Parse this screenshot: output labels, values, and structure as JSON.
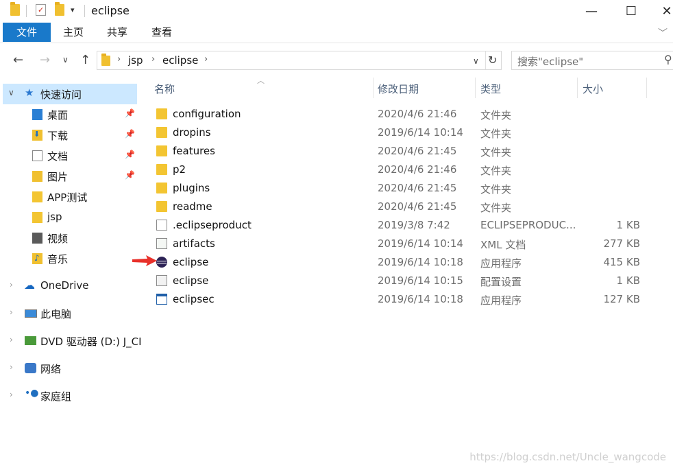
{
  "window": {
    "title": "eclipse",
    "minimize": "—",
    "maximize": "☐",
    "close": "✕"
  },
  "ribbon": {
    "tabs": [
      "文件",
      "主页",
      "共享",
      "查看"
    ],
    "expand": "﹀"
  },
  "address": {
    "breadcrumbs": [
      "jsp",
      "eclipse"
    ],
    "search_placeholder": "搜索\"eclipse\""
  },
  "nav": {
    "quick_access": "快速访问",
    "quick_items": [
      {
        "label": "桌面",
        "pinned": true
      },
      {
        "label": "下载",
        "pinned": true
      },
      {
        "label": "文档",
        "pinned": true
      },
      {
        "label": "图片",
        "pinned": true
      },
      {
        "label": "APP测试",
        "pinned": false
      },
      {
        "label": "jsp",
        "pinned": false
      },
      {
        "label": "视频",
        "pinned": false
      },
      {
        "label": "音乐",
        "pinned": false
      }
    ],
    "roots": [
      "OneDrive",
      "此电脑",
      "DVD 驱动器 (D:) J_CI",
      "网络",
      "家庭组"
    ]
  },
  "columns": [
    "名称",
    "修改日期",
    "类型",
    "大小"
  ],
  "files": [
    {
      "name": "configuration",
      "date": "2020/4/6 21:46",
      "type": "文件夹",
      "size": "",
      "icon": "folder"
    },
    {
      "name": "dropins",
      "date": "2019/6/14 10:14",
      "type": "文件夹",
      "size": "",
      "icon": "folder"
    },
    {
      "name": "features",
      "date": "2020/4/6 21:45",
      "type": "文件夹",
      "size": "",
      "icon": "folder"
    },
    {
      "name": "p2",
      "date": "2020/4/6 21:46",
      "type": "文件夹",
      "size": "",
      "icon": "folder"
    },
    {
      "name": "plugins",
      "date": "2020/4/6 21:45",
      "type": "文件夹",
      "size": "",
      "icon": "folder"
    },
    {
      "name": "readme",
      "date": "2020/4/6 21:45",
      "type": "文件夹",
      "size": "",
      "icon": "folder"
    },
    {
      "name": ".eclipseproduct",
      "date": "2019/3/8 7:42",
      "type": "ECLIPSEPRODUC...",
      "size": "1 KB",
      "icon": "file"
    },
    {
      "name": "artifacts",
      "date": "2019/6/14 10:14",
      "type": "XML 文档",
      "size": "277 KB",
      "icon": "xml"
    },
    {
      "name": "eclipse",
      "date": "2019/6/14 10:18",
      "type": "应用程序",
      "size": "415 KB",
      "icon": "eclipse"
    },
    {
      "name": "eclipse",
      "date": "2019/6/14 10:15",
      "type": "配置设置",
      "size": "1 KB",
      "icon": "ini"
    },
    {
      "name": "eclipsec",
      "date": "2019/6/14 10:18",
      "type": "应用程序",
      "size": "127 KB",
      "icon": "app"
    }
  ],
  "watermark": "https://blog.csdn.net/Uncle_wangcode",
  "colors": {
    "accent": "#1979ca",
    "selected": "#cce8ff",
    "arrow": "#e8302a"
  }
}
